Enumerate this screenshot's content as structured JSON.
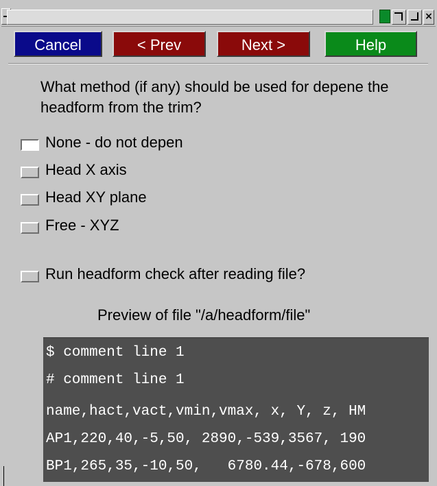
{
  "buttons": {
    "cancel": "Cancel",
    "prev": "< Prev",
    "next": "Next >",
    "help": "Help"
  },
  "question": "What method (if any) should be used for depene the headform from the trim?",
  "options": [
    {
      "label": "None - do not depen",
      "selected": true
    },
    {
      "label": "Head X axis",
      "selected": false
    },
    {
      "label": "Head XY plane",
      "selected": false
    },
    {
      "label": "Free - XYZ",
      "selected": false
    }
  ],
  "run_check": {
    "label": "Run headform check after reading file?",
    "checked": false
  },
  "preview": {
    "title": "Preview of file \"/a/headform/file\"",
    "lines": [
      "$ comment line 1",
      "# comment line 1",
      "name,hact,vact,vmin,vmax, x, Y, z, HM",
      "AP1,220,40,-5,50, 2890,-539,3567, 190",
      "BP1,265,35,-10,50,   6780.44,-678,600"
    ]
  },
  "colors": {
    "cancel": "#0a0a8a",
    "prev": "#8a0a0a",
    "next": "#8a0a0a",
    "help": "#0a8a1a",
    "preview_bg": "#4e4e4e",
    "background": "#c6c6c6"
  },
  "icons": [
    "window-menu-icon",
    "green-indicator-icon",
    "minimize-icon",
    "maximize-icon",
    "close-icon"
  ]
}
